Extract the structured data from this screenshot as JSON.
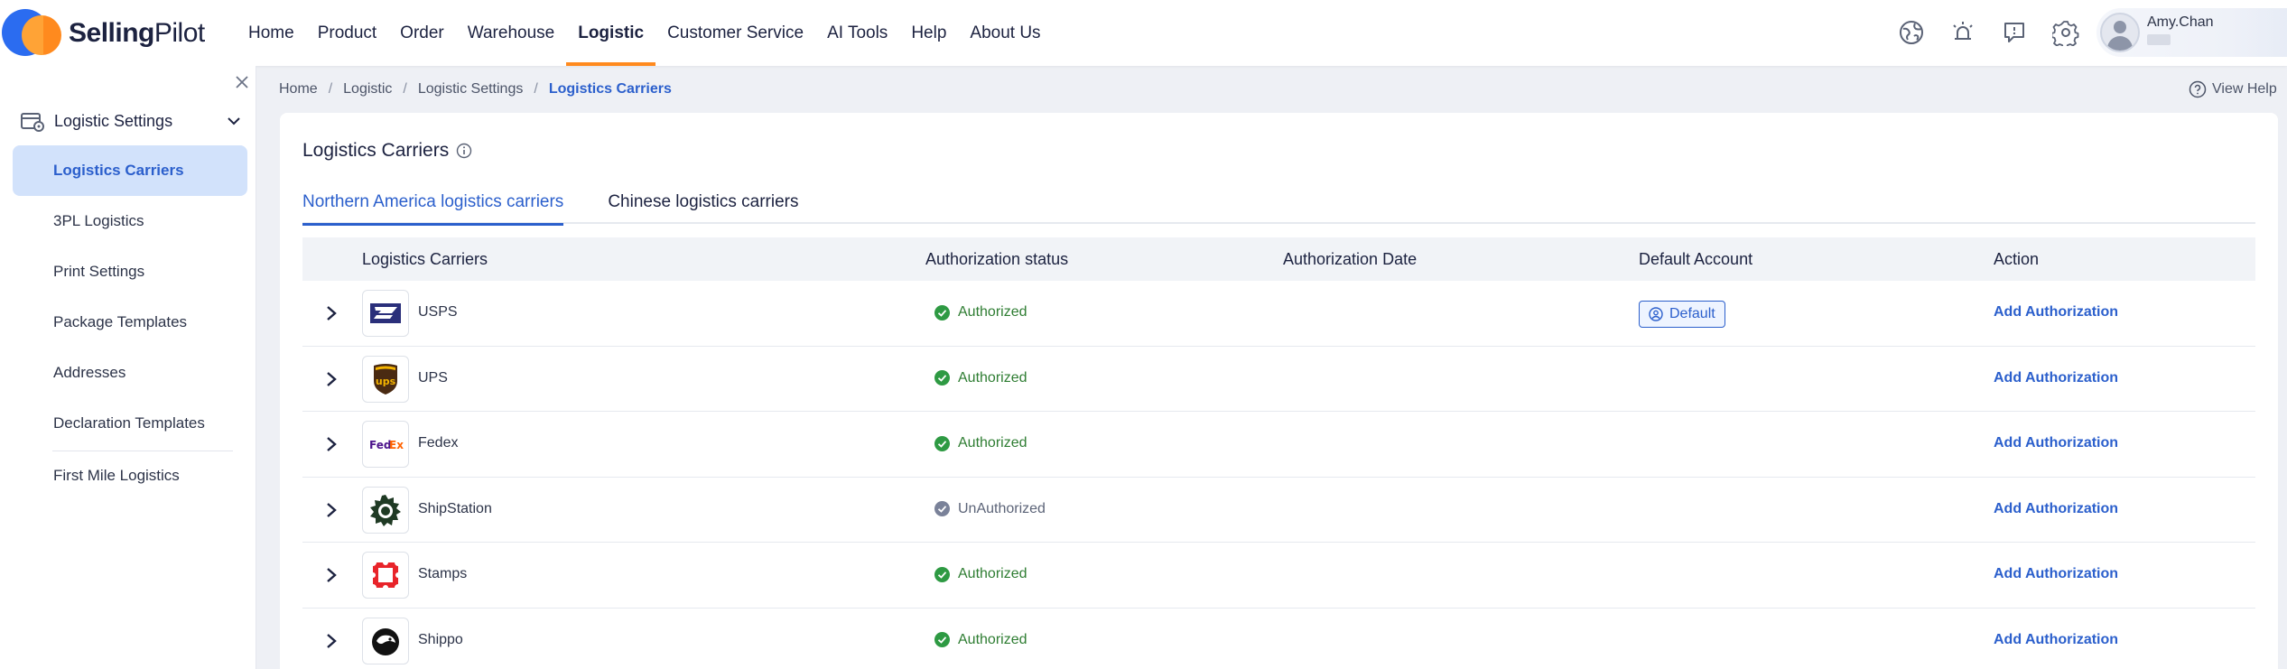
{
  "brand": {
    "bold": "Selling",
    "regular": "Pilot"
  },
  "nav": {
    "items": [
      "Home",
      "Product",
      "Order",
      "Warehouse",
      "Logistic",
      "Customer Service",
      "AI Tools",
      "Help",
      "About Us"
    ],
    "active": "Logistic",
    "accent": "#ff8a1e"
  },
  "user": {
    "name": "Amy.Chan"
  },
  "sidebar": {
    "group_label": "Logistic Settings",
    "items": [
      "Logistics Carriers",
      "3PL Logistics",
      "Print Settings",
      "Package Templates",
      "Addresses",
      "Declaration Templates",
      "First Mile Logistics"
    ],
    "active": "Logistics Carriers"
  },
  "breadcrumb": [
    "Home",
    "Logistic",
    "Logistic Settings",
    "Logistics Carriers"
  ],
  "help_label": "View Help",
  "page": {
    "title": "Logistics Carriers",
    "tabs": [
      "Northern America logistics carriers",
      "Chinese logistics carriers"
    ],
    "active_tab": "Northern America logistics carriers"
  },
  "table": {
    "columns": [
      "Logistics Carriers",
      "Authorization status",
      "Authorization Date",
      "Default Account",
      "Action"
    ],
    "rows": [
      {
        "carrier": "USPS",
        "logo": "usps-icon",
        "status": "Authorized",
        "authorized": true,
        "date": "",
        "default": "Default",
        "action": "Add Authorization"
      },
      {
        "carrier": "UPS",
        "logo": "ups-icon",
        "status": "Authorized",
        "authorized": true,
        "date": "",
        "default": "",
        "action": "Add Authorization"
      },
      {
        "carrier": "Fedex",
        "logo": "fedex-icon",
        "status": "Authorized",
        "authorized": true,
        "date": "",
        "default": "",
        "action": "Add Authorization"
      },
      {
        "carrier": "ShipStation",
        "logo": "shipstation-icon",
        "status": "UnAuthorized",
        "authorized": false,
        "date": "",
        "default": "",
        "action": "Add Authorization"
      },
      {
        "carrier": "Stamps",
        "logo": "stamps-icon",
        "status": "Authorized",
        "authorized": true,
        "date": "",
        "default": "",
        "action": "Add Authorization"
      },
      {
        "carrier": "Shippo",
        "logo": "shippo-icon",
        "status": "Authorized",
        "authorized": true,
        "date": "",
        "default": "",
        "action": "Add Authorization"
      }
    ]
  },
  "colors": {
    "primary": "#2b5fcc",
    "authorized": "#2e7d32",
    "unauthorized": "#7a8299"
  }
}
